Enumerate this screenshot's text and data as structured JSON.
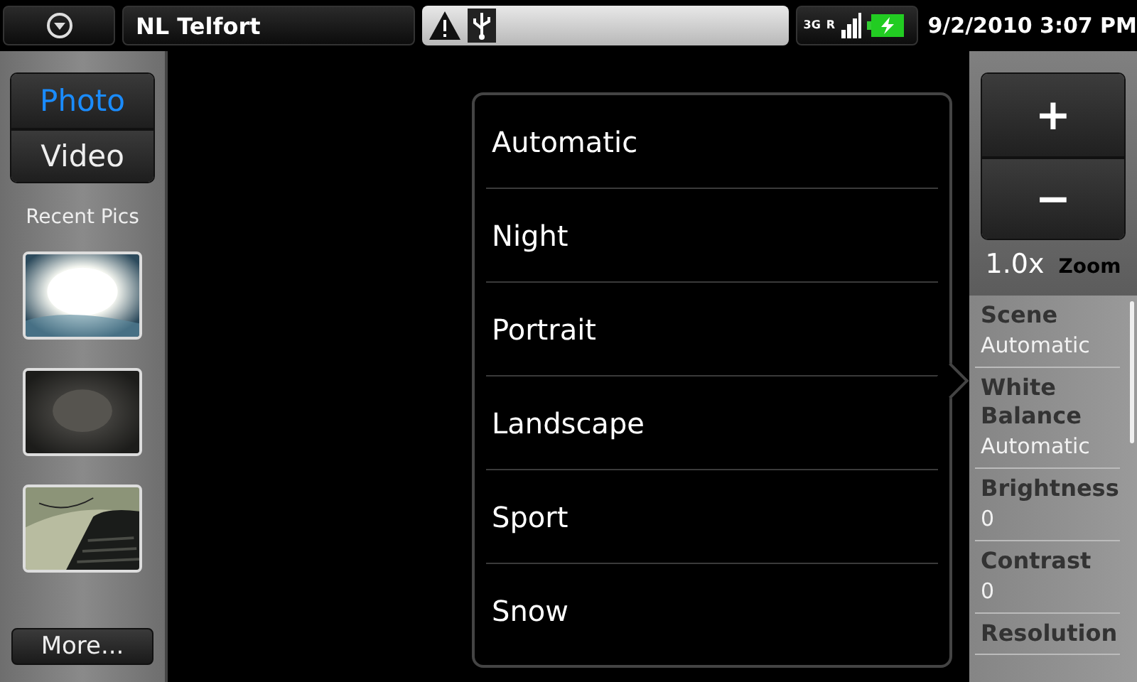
{
  "status_bar": {
    "carrier": "NL Telfort",
    "network": "3G",
    "roaming": "R",
    "clock": "9/2/2010 3:07 PM"
  },
  "mode_switch": [
    {
      "label": "Photo",
      "selected": true
    },
    {
      "label": "Video",
      "selected": false
    }
  ],
  "recent": {
    "title": "Recent Pics",
    "more": "More..."
  },
  "scene_menu": {
    "items": [
      "Automatic",
      "Night",
      "Portrait",
      "Landscape",
      "Sport",
      "Snow"
    ]
  },
  "zoom": {
    "plus": "+",
    "minus": "−",
    "value": "1.0x",
    "label": "Zoom"
  },
  "settings": [
    {
      "name": "Scene",
      "value": "Automatic"
    },
    {
      "name": "White Balance",
      "value": "Automatic"
    },
    {
      "name": "Brightness",
      "value": "0"
    },
    {
      "name": "Contrast",
      "value": "0"
    },
    {
      "name": "Resolution"
    }
  ]
}
